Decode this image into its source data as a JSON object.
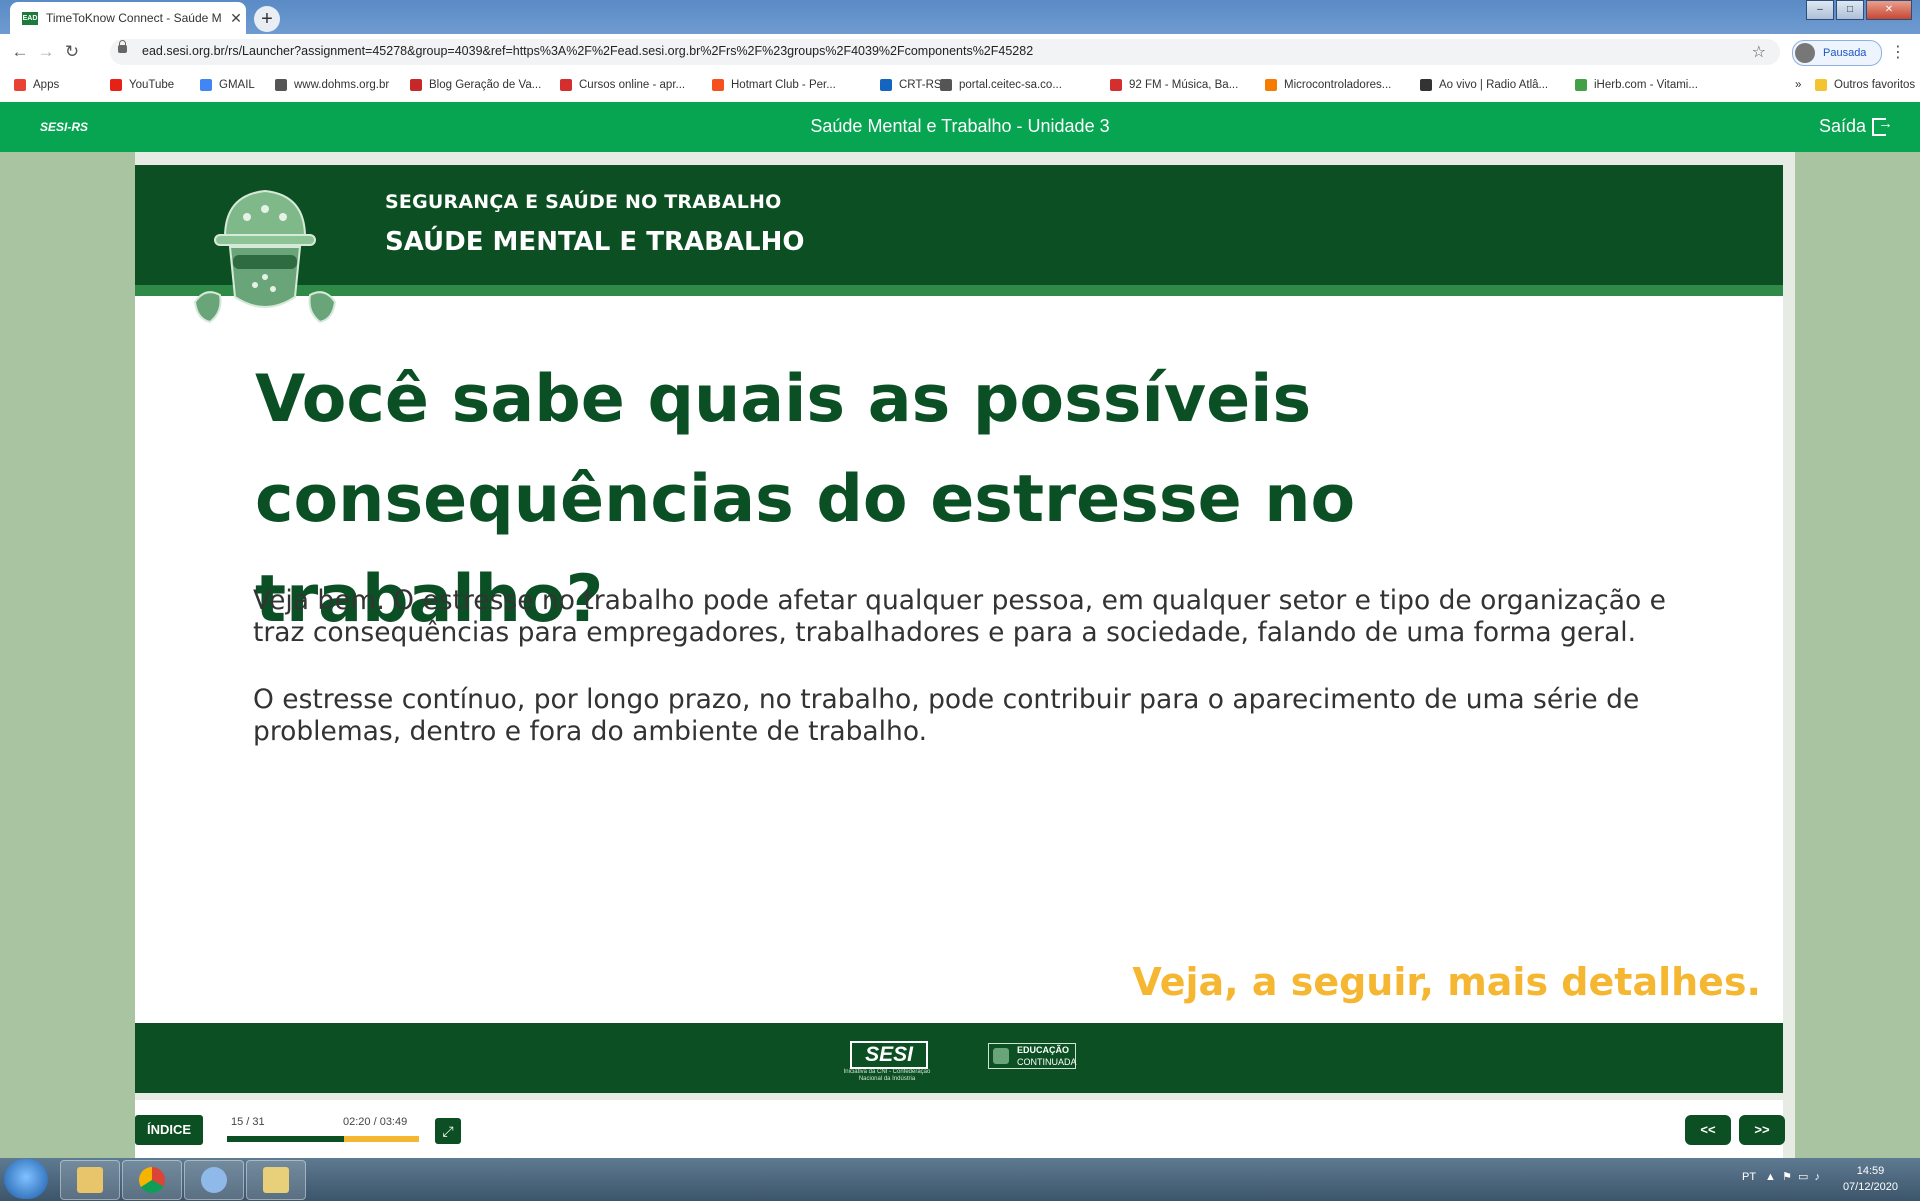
{
  "browser": {
    "tab_title": "TimeToKnow Connect - Saúde M",
    "tab_favicon": "EAD",
    "url": "ead.sesi.org.br/rs/Launcher?assignment=45278&group=4039&ref=https%3A%2F%2Fead.sesi.org.br%2Frs%2F%23groups%2F4039%2Fcomponents%2F45282",
    "profile_label": "Pausada",
    "bookmarks": [
      {
        "label": "Apps",
        "color": "#e94235"
      },
      {
        "label": "YouTube",
        "color": "#e62117"
      },
      {
        "label": "GMAIL",
        "color": "#4285f4"
      },
      {
        "label": "www.dohms.org.br",
        "color": "#555555"
      },
      {
        "label": "Blog Geração de Va...",
        "color": "#c62828"
      },
      {
        "label": "Cursos online - apr...",
        "color": "#d32f2f"
      },
      {
        "label": "Hotmart Club - Per...",
        "color": "#f4511e"
      },
      {
        "label": "CRT-RS",
        "color": "#1565c0"
      },
      {
        "label": "portal.ceitec-sa.co...",
        "color": "#555555"
      },
      {
        "label": "92 FM - Música, Ba...",
        "color": "#d32f2f"
      },
      {
        "label": "Microcontroladores...",
        "color": "#f57c00"
      },
      {
        "label": "Ao vivo | Radio Atlâ...",
        "color": "#333333"
      },
      {
        "label": "iHerb.com - Vitami...",
        "color": "#43a047"
      }
    ],
    "bookmarks_more": "»",
    "other_bookmarks": "Outros favoritos"
  },
  "app": {
    "logo": "SESI-RS",
    "course_title": "Saúde Mental e Trabalho - Unidade 3",
    "exit_label": "Saída"
  },
  "slide": {
    "kicker": "SEGURANÇA E SAÚDE NO TRABALHO",
    "title": "SAÚDE MENTAL E TRABALHO",
    "headline": "Você sabe quais as possíveis consequências do estresse no trabalho?",
    "paragraphs": [
      "Veja bem. O estresse no trabalho pode afetar qualquer pessoa, em qualquer setor e tipo de organização e traz consequências para empregadores, trabalhadores e para a sociedade, falando de uma forma geral.",
      "O estresse contínuo, por longo prazo, no trabalho, pode contribuir para o aparecimento de uma série de problemas, dentro e fora do ambiente de trabalho."
    ],
    "cta": "Veja, a seguir, mais detalhes.",
    "footer_logo": "SESI",
    "footer_logo_sub": "Iniciativa da CNI - Confederação Nacional da Indústria",
    "footer_badge_line1": "EDUCAÇÃO",
    "footer_badge_line2": "CONTINUADA"
  },
  "player": {
    "index_label": "ÍNDICE",
    "page": "15 / 31",
    "time": "02:20 / 03:49",
    "progress": 0.61,
    "prev_label": "<<",
    "next_label": ">>"
  },
  "taskbar": {
    "language": "PT",
    "time": "14:59",
    "date": "07/12/2020"
  },
  "colors": {
    "app_green": "#07a451",
    "dark_green": "#0c4f22",
    "accent_yellow": "#f5b731"
  }
}
